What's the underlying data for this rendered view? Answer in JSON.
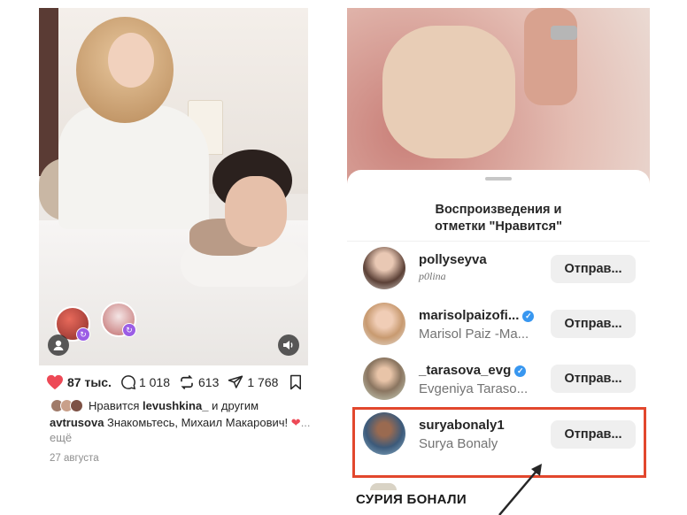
{
  "post": {
    "likes": "87 тыс.",
    "comments": "1 018",
    "reposts": "613",
    "shares": "1 768",
    "liked_by_prefix": "Нравится",
    "liked_by_user": "levushkina_",
    "liked_by_suffix": "и другим",
    "author": "avtrusova",
    "caption_text": "Знакомьтесь, Михаил Макарович!",
    "caption_more": "... ещё",
    "date": "27 августа"
  },
  "sheet": {
    "title_line1": "Воспроизведения и",
    "title_line2": "отметки \"Нравится\"",
    "rows": [
      {
        "username": "pollyseyva",
        "fullname": "p0lina",
        "verified": false,
        "button": "Отправ..."
      },
      {
        "username": "marisolpaizofi...",
        "fullname": "Marisol Paiz -Ma...",
        "verified": true,
        "button": "Отправ..."
      },
      {
        "username": "_tarasova_evg",
        "fullname": "Evgeniya Taraso...",
        "verified": true,
        "button": "Отправ..."
      },
      {
        "username": "suryabonaly1",
        "fullname": "Surya Bonaly",
        "verified": false,
        "button": "Отправ..."
      }
    ]
  },
  "annotation": {
    "label": "СУРИЯ БОНАЛИ",
    "color": "#e2472d"
  },
  "colors": {
    "like_heart": "#ed4956",
    "verified": "#3897f0",
    "highlight": "#e2472d"
  }
}
